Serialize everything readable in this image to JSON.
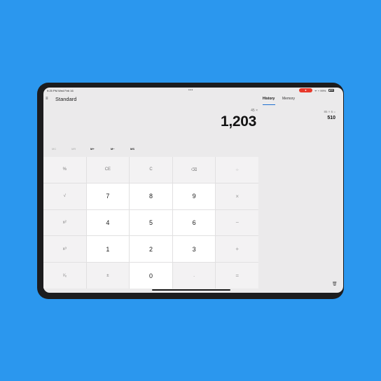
{
  "status": {
    "time": "9:25 PM  Wed Feb 16",
    "dots": "•••",
    "rec": "●",
    "icons": "ᯤ ⌁ 99%"
  },
  "header": {
    "menu_icon": "hamburger-menu-icon",
    "menu_glyph": "≡",
    "mode": "Standard"
  },
  "display": {
    "expression": "45 ×",
    "value": "1,203"
  },
  "memory": [
    {
      "label": "MC",
      "enabled": false
    },
    {
      "label": "MR",
      "enabled": false
    },
    {
      "label": "M+",
      "enabled": true
    },
    {
      "label": "M−",
      "enabled": true
    },
    {
      "label": "MS",
      "enabled": true
    }
  ],
  "keypad": [
    [
      "%",
      "CE",
      "C",
      "⌫",
      "÷"
    ],
    [
      "√",
      "7",
      "8",
      "9",
      "×"
    ],
    [
      "x²",
      "4",
      "5",
      "6",
      "−"
    ],
    [
      "x³",
      "1",
      "2",
      "3",
      "+"
    ],
    [
      "¹⁄ₓ",
      "±",
      "0",
      ".",
      "="
    ]
  ],
  "tabs": {
    "history": "History",
    "memory": "Memory"
  },
  "history": {
    "expression": "85 × 6 =",
    "result": "510"
  },
  "icons": {
    "trash": "trash-icon",
    "trash_glyph": "🗑"
  },
  "colors": {
    "background": "#2b97ee",
    "accent": "#1f6fd1",
    "rec": "#e8392b"
  }
}
